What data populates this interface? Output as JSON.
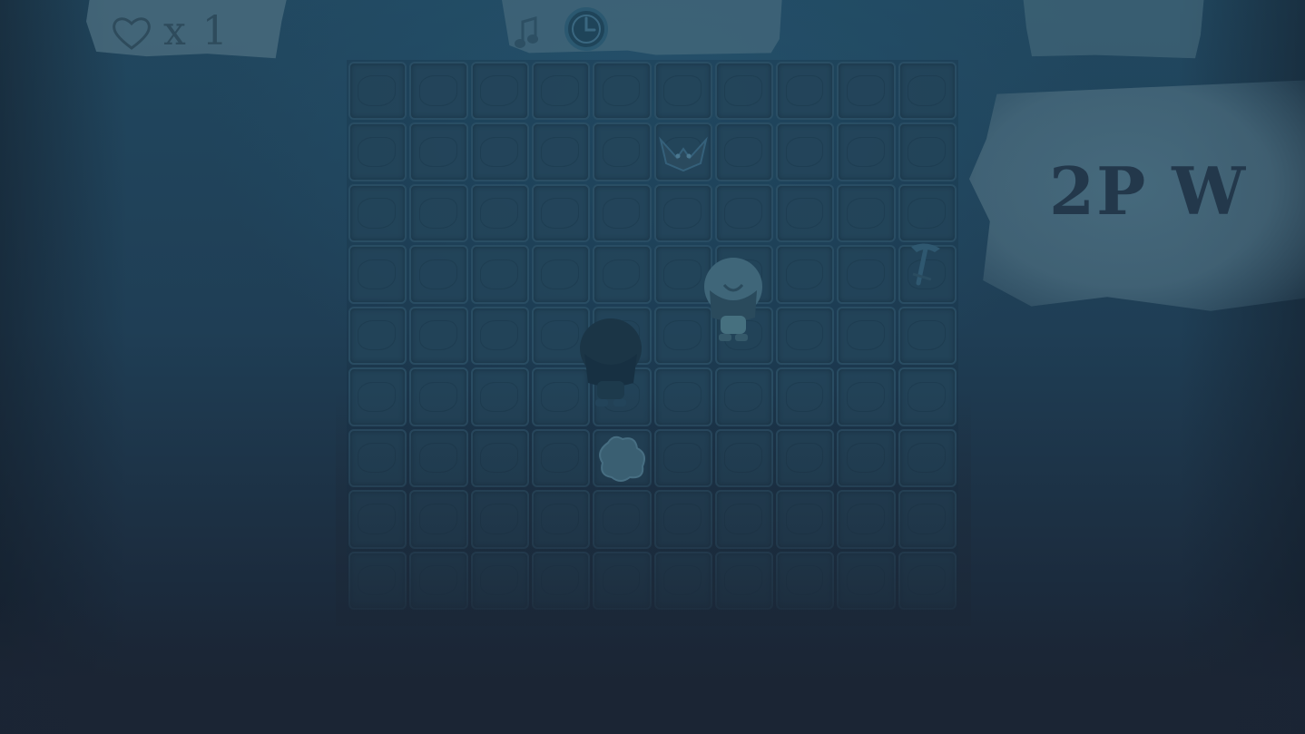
{
  "hud": {
    "lives_label": "x 1",
    "lives_icon": "heart-icon",
    "timer_icon": "clock-icon",
    "music_icon": "music-note-icon"
  },
  "board": {
    "columns": 10,
    "rows": 9,
    "tile_icon": "dirt-tile"
  },
  "characters": [
    {
      "name": "player-white",
      "icon": "white-hooded-character"
    },
    {
      "name": "player-dark",
      "icon": "dark-hooded-character"
    },
    {
      "name": "dust-cloud",
      "icon": "dust-cloud"
    },
    {
      "name": "bird-creature",
      "icon": "bird-creature"
    },
    {
      "name": "pickaxe",
      "icon": "pickaxe"
    }
  ],
  "banner": {
    "text": "2P W"
  },
  "colors": {
    "background": "#1b2838",
    "tile": "#24455a",
    "paper": "#4d6f80",
    "banner_text": "#23384b"
  }
}
